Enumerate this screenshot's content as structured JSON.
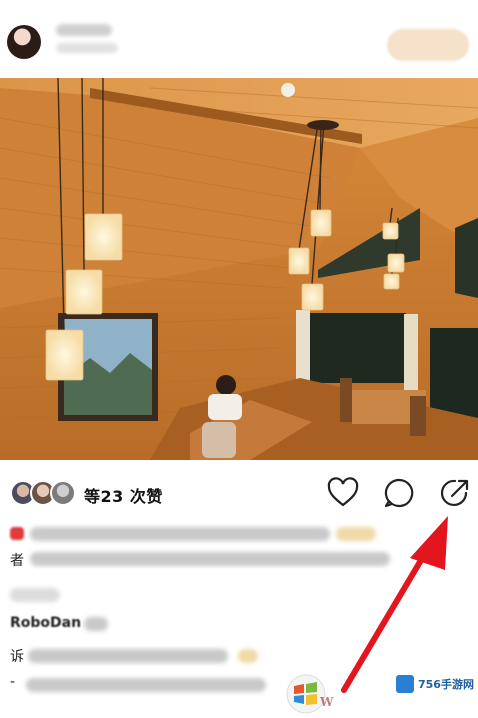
{
  "post": {
    "likes_text": "等23 次赞",
    "reply_prefix": "诉",
    "reply_handle": "RoboDan",
    "line_start_1": "者",
    "line_start_2": "-"
  },
  "watermark": {
    "text": "756手游网"
  },
  "colors": {
    "accent_arrow": "#e3151e",
    "photo_wood": "#c9792f",
    "follow_button": "#f6e1ca"
  },
  "icons": [
    "heart-icon",
    "comment-icon",
    "share-icon",
    "windows-logo-icon"
  ]
}
